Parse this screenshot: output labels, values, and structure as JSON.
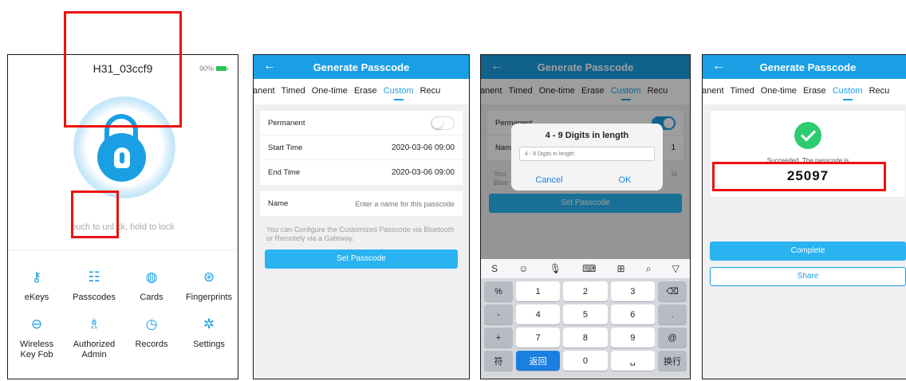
{
  "colors": {
    "accent": "#1a9fe4",
    "button": "#29b3f0",
    "success": "#2ecc71",
    "highlight": "#ee1111",
    "battery": "#29c451"
  },
  "panel1": {
    "device_name": "H31_03ccf9",
    "battery": "90%",
    "hint": "ouch to unl    ck, hold to lock",
    "menu": [
      {
        "label": "eKeys",
        "icon": "user-key-icon",
        "glyph": "⚷"
      },
      {
        "label": "Passcodes",
        "icon": "passcode-list-icon",
        "glyph": "☷"
      },
      {
        "label": "Cards",
        "icon": "card-icon",
        "glyph": "◍"
      },
      {
        "label": "Fingerprints",
        "icon": "fingerprint-icon",
        "glyph": "⊛"
      },
      {
        "label": "Wireless Key Fob",
        "icon": "key-fob-icon",
        "glyph": "⊖"
      },
      {
        "label": "Authorized Admin",
        "icon": "admin-icon",
        "glyph": "♗"
      },
      {
        "label": "Records",
        "icon": "records-clock-icon",
        "glyph": "◷"
      },
      {
        "label": "Settings",
        "icon": "settings-gear-icon",
        "glyph": "✲"
      }
    ]
  },
  "generate": {
    "title": "Generate Passcode",
    "back_glyph": "←",
    "tabs": [
      "anent",
      "Timed",
      "One-time",
      "Erase",
      "Custom",
      "Recu"
    ]
  },
  "panel2": {
    "permanent_label": "Permanent",
    "start_label": "Start Time",
    "start_value": "2020-03-06 09:00",
    "end_label": "End Time",
    "end_value": "2020-03-06 09:00",
    "name_label": "Name",
    "name_placeholder": "Enter a name for this passcode",
    "note": "You can Configure the Customized Passcode via Bluetooth or Remotely via a Gateway.",
    "button": "Set Passcode"
  },
  "panel3": {
    "bg_permanent": "Permanent",
    "bg_name": "Nam",
    "bg_value": "1",
    "bg_note1": "You",
    "bg_note2": "Blue",
    "bg_via": "ia",
    "dialog_title": "4 - 9 Digits in length",
    "dialog_placeholder": "4 - 9 Digits in length",
    "cancel": "Cancel",
    "ok": "OK",
    "button": "Set Passcode",
    "kb_bar": [
      "S",
      "☺",
      "🎙",
      "⌨",
      "⊞",
      "⌕",
      "▽"
    ],
    "keys": [
      "%",
      "1",
      "2",
      "3",
      "⌫",
      "-",
      "4",
      "5",
      "6",
      ".",
      "+",
      "7",
      "8",
      "9",
      "@",
      "符",
      "返回",
      "0",
      "␣",
      "换行"
    ]
  },
  "panel4": {
    "result_label": "Succeeded. The passcode is",
    "code": "25097",
    "complete": "Complete",
    "share": "Share"
  }
}
